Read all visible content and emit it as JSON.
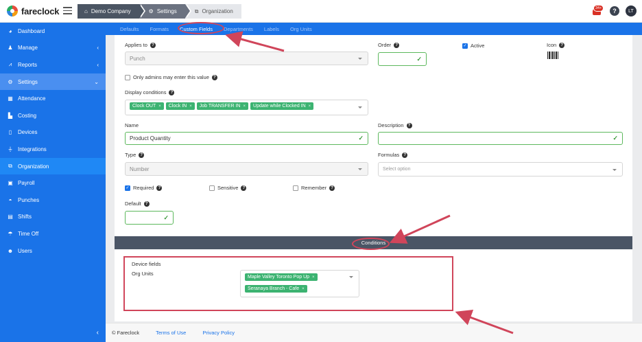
{
  "app": {
    "logo_text": "fareclock",
    "colors": {
      "brand": "#1a73e8",
      "accent_green": "#3cb371",
      "annotation_red": "#d0455a"
    }
  },
  "breadcrumb": [
    {
      "label": "Demo Company",
      "icon": "home-icon"
    },
    {
      "label": "Settings",
      "icon": "gear-icon"
    },
    {
      "label": "Organization",
      "icon": "org-chart-icon"
    }
  ],
  "header": {
    "notification_badge": "34+",
    "help_label": "?",
    "avatar_initials": "LT"
  },
  "sidebar": {
    "items": [
      {
        "label": "Dashboard",
        "icon": "palette-icon"
      },
      {
        "label": "Manage",
        "icon": "user-icon",
        "has_children": true
      },
      {
        "label": "Reports",
        "icon": "chart-icon",
        "has_children": true
      },
      {
        "label": "Settings",
        "icon": "gear-icon",
        "has_children": true,
        "state": "expanded"
      },
      {
        "label": "Attendance",
        "icon": "calendar-icon"
      },
      {
        "label": "Costing",
        "icon": "factory-icon"
      },
      {
        "label": "Devices",
        "icon": "tablet-icon"
      },
      {
        "label": "Integrations",
        "icon": "plug-icon"
      },
      {
        "label": "Organization",
        "icon": "org-chart-icon",
        "state": "selected"
      },
      {
        "label": "Payroll",
        "icon": "money-icon"
      },
      {
        "label": "Punches",
        "icon": "car-icon"
      },
      {
        "label": "Shifts",
        "icon": "briefcase-icon"
      },
      {
        "label": "Time Off",
        "icon": "umbrella-icon"
      },
      {
        "label": "Users",
        "icon": "users-icon"
      }
    ],
    "collapse_label": "‹"
  },
  "tabs": [
    {
      "label": "Defaults"
    },
    {
      "label": "Formats"
    },
    {
      "label": "Custom Fields",
      "active": true
    },
    {
      "label": "Departments"
    },
    {
      "label": "Labels"
    },
    {
      "label": "Org Units"
    }
  ],
  "form": {
    "applies_to": {
      "label": "Applies to",
      "value": "Punch"
    },
    "only_admins": {
      "label": "Only admins may enter this value",
      "checked": false
    },
    "display_conditions": {
      "label": "Display conditions",
      "chips": [
        "Clock OUT",
        "Clock IN",
        "Job TRANSFER IN",
        "Update while Clocked IN"
      ]
    },
    "name": {
      "label": "Name",
      "value": "Product Quantity"
    },
    "type": {
      "label": "Type",
      "value": "Number"
    },
    "required": {
      "label": "Required",
      "checked": true
    },
    "sensitive": {
      "label": "Sensitive",
      "checked": false
    },
    "remember": {
      "label": "Remember",
      "checked": false
    },
    "default": {
      "label": "Default",
      "value": ""
    },
    "order": {
      "label": "Order",
      "value": ""
    },
    "active": {
      "label": "Active",
      "checked": true
    },
    "icon": {
      "label": "Icon",
      "value_icon": "barcode-icon"
    },
    "description": {
      "label": "Description",
      "value": ""
    },
    "formulas": {
      "label": "Formulas",
      "placeholder": "Select option"
    }
  },
  "conditions": {
    "title": "Conditions",
    "device_fields_label": "Device fields",
    "org_units_label": "Org Units",
    "org_units": [
      "Maple Valley Toronto Pop Up",
      "Seranaya Branch - Cafe"
    ]
  },
  "footer": {
    "copyright": "© Fareclock",
    "terms": "Terms of Use",
    "privacy": "Privacy Policy"
  }
}
